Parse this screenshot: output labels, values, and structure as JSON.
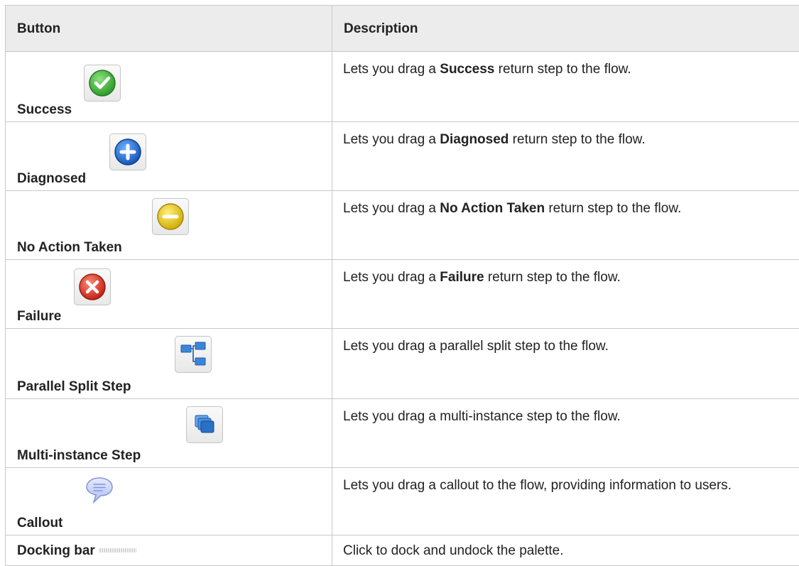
{
  "table": {
    "headers": [
      "Button",
      "Description"
    ],
    "rows": [
      {
        "button": "Success",
        "icon": "success-check-icon",
        "desc_pre": "Lets you drag a ",
        "desc_bold": "Success",
        "desc_post": " return step to the flow."
      },
      {
        "button": "Diagnosed",
        "icon": "diagnosed-plus-icon",
        "desc_pre": "Lets you drag a ",
        "desc_bold": "Diagnosed",
        "desc_post": " return step to the flow."
      },
      {
        "button": "No Action Taken",
        "icon": "no-action-minus-icon",
        "desc_pre": "Lets you drag a ",
        "desc_bold": "No Action Taken",
        "desc_post": " return step to the flow."
      },
      {
        "button": "Failure",
        "icon": "failure-x-icon",
        "desc_pre": "Lets you drag a ",
        "desc_bold": "Failure",
        "desc_post": " return step to the flow."
      },
      {
        "button": "Parallel Split Step",
        "icon": "parallel-split-icon",
        "desc": "Lets you drag a parallel split step to the flow."
      },
      {
        "button": "Multi-instance Step",
        "icon": "multi-instance-icon",
        "desc": "Lets you drag a multi-instance step to the flow."
      },
      {
        "button": "Callout",
        "icon": "callout-bubble-icon",
        "desc": "Lets you drag a callout to the flow, providing information to users."
      },
      {
        "button": "Docking bar",
        "icon": "docking-bar-icon",
        "desc": "Click to dock and undock the palette."
      }
    ]
  },
  "colors": {
    "header_bg": "#ececec",
    "border": "#c8c8c8",
    "success": "#3aa636",
    "diagnosed": "#1e6fd0",
    "no_action": "#e3c21a",
    "failure": "#d63a2a"
  }
}
